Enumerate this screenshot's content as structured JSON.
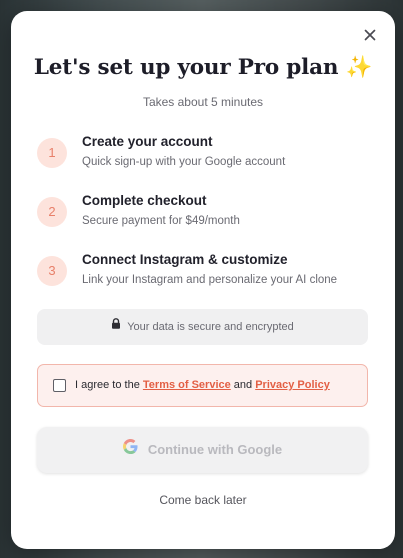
{
  "modal": {
    "title": "Let's set up your Pro plan",
    "title_emoji": "✨",
    "subtitle": "Takes about 5 minutes",
    "close_icon": "close-icon"
  },
  "steps": [
    {
      "number": "1",
      "title": "Create your account",
      "description": "Quick sign-up with your Google account"
    },
    {
      "number": "2",
      "title": "Complete checkout",
      "description": "Secure payment for $49/month"
    },
    {
      "number": "3",
      "title": "Connect Instagram & customize",
      "description": "Link your Instagram and personalize your AI clone"
    }
  ],
  "security_note": {
    "icon": "lock-icon",
    "text": "Your data is secure and encrypted"
  },
  "agreement": {
    "checked": false,
    "prefix": "I agree to the ",
    "terms_link": "Terms of Service",
    "conjunction": " and ",
    "privacy_link": "Privacy Policy"
  },
  "google_button": {
    "label": "Continue with Google",
    "icon": "google-icon",
    "disabled": true
  },
  "later_link": "Come back later",
  "colors": {
    "accent": "#e35f44",
    "step_badge_bg": "#fde3dc",
    "step_badge_text": "#e8806a",
    "agree_bg": "#fdf0ee",
    "agree_border": "#f2b6ab"
  }
}
